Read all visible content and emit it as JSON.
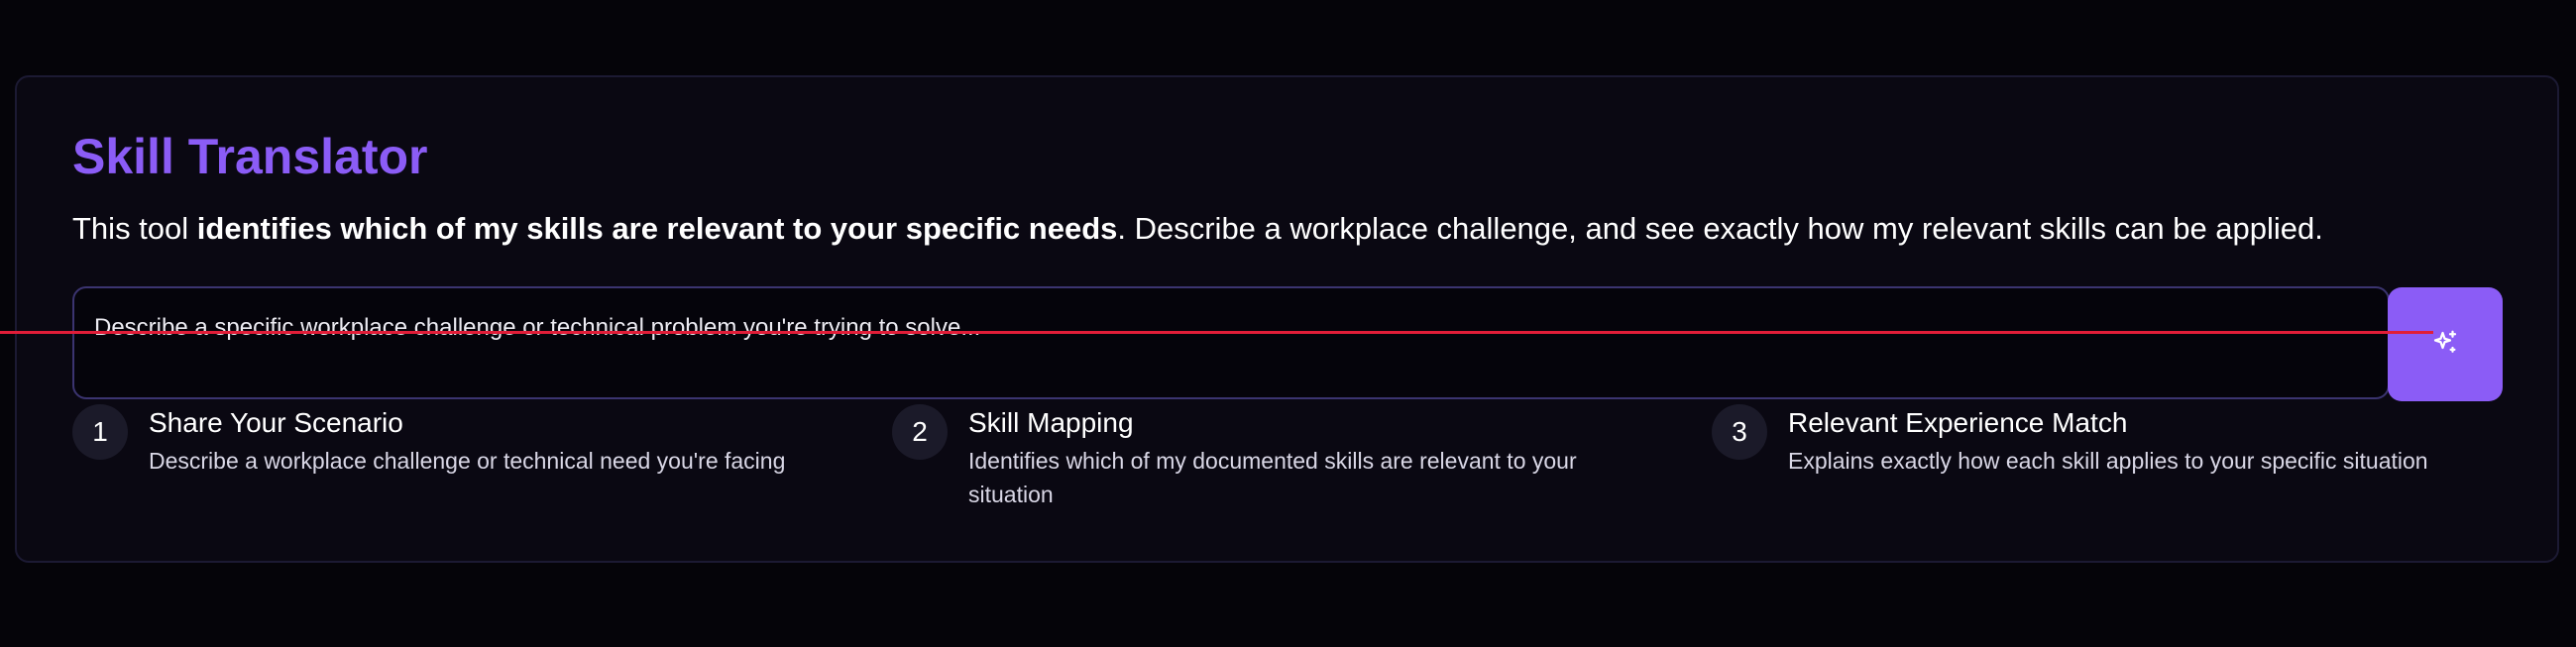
{
  "colors": {
    "background": "#050409",
    "card": "#0a0812",
    "accent": "#8b5cf6",
    "underline": "#e11d38"
  },
  "header": {
    "title": "Skill Translator",
    "intro_prefix": "This tool ",
    "intro_bold": "identifies which of my skills are relevant to your specific needs",
    "intro_suffix": ". Describe a workplace challenge, and see exactly how my relevant skills can be applied."
  },
  "scenario_input": {
    "placeholder": "Describe a specific workplace challenge or technical problem you're trying to solve...",
    "value": ""
  },
  "submit_button": {
    "icon": "sparkles-icon"
  },
  "steps": [
    {
      "number": "1",
      "title": "Share Your Scenario",
      "description": "Describe a workplace challenge or technical need you're facing"
    },
    {
      "number": "2",
      "title": "Skill Mapping",
      "description": "Identifies which of my documented skills are relevant to your situation"
    },
    {
      "number": "3",
      "title": "Relevant Experience Match",
      "description": "Explains exactly how each skill applies to your specific situation"
    }
  ]
}
